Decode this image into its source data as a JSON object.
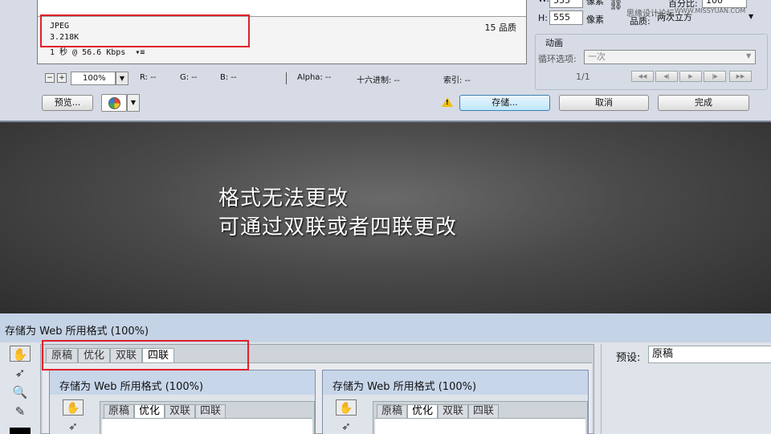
{
  "top_dialog": {
    "preview": {
      "format": "JPEG",
      "size": "3.218K",
      "time": "1 秒 @ 56.6 Kbps",
      "quality": "15 品质"
    },
    "statusbar": {
      "zoom_minus": "−",
      "zoom_plus": "+",
      "zoom": "100%",
      "r": "R: --",
      "g": "G: --",
      "b": "B: --",
      "alpha": "Alpha: --",
      "hex": "十六进制: --",
      "index": "索引: --"
    },
    "buttons": {
      "preview": "预览...",
      "save": "存储...",
      "cancel": "取消",
      "done": "完成"
    },
    "image_size": {
      "w_label": "W:",
      "w_value": "555",
      "h_label": "H:",
      "h_value": "555",
      "unit": "像素",
      "percent_label": "百分比:",
      "percent_value": "100",
      "quality_label": "品质:",
      "quality_value": "两次立方"
    },
    "animation": {
      "title": "动画",
      "loop_label": "循环选项:",
      "loop_value": "一次",
      "frame": "1/1"
    },
    "watermark": "思缘设计论坛",
    "watermark_en": "WWW.MISSYUAN.COM"
  },
  "caption": {
    "line1": "格式无法更改",
    "line2": "可通过双联或者四联更改"
  },
  "bottom_dialog": {
    "title": "存储为 Web 所用格式 (100%)",
    "tabs": [
      "原稿",
      "优化",
      "双联",
      "四联"
    ],
    "active_tab": 3,
    "sub_dialogs": [
      {
        "title": "存储为 Web 所用格式 (100%)",
        "tabs": [
          "原稿",
          "优化",
          "双联",
          "四联"
        ],
        "active_tab": 1
      },
      {
        "title": "存储为 Web 所用格式 (100%)",
        "tabs": [
          "原稿",
          "优化",
          "双联",
          "四联"
        ],
        "active_tab": 1
      }
    ],
    "preset": {
      "label": "预设:",
      "value": "原稿"
    }
  },
  "colors": {
    "highlight_box": "#e0202a",
    "caption_text": "#ffffff"
  }
}
